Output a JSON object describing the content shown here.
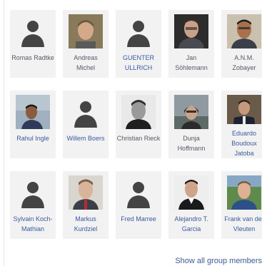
{
  "members": [
    {
      "name": "Romas Radtke",
      "has_photo": false,
      "link_color": false
    },
    {
      "name": "Andreas Michel",
      "has_photo": true,
      "link_color": false
    },
    {
      "name": "GUENTER ULLRICH",
      "has_photo": false,
      "link_color": true
    },
    {
      "name": "Jan Söhlemann",
      "has_photo": true,
      "link_color": false
    },
    {
      "name": "A.N.M. Zobayer",
      "has_photo": true,
      "link_color": false
    },
    {
      "name": "Rahul Ingle",
      "has_photo": true,
      "link_color": true
    },
    {
      "name": "Willem Boers",
      "has_photo": false,
      "link_color": true
    },
    {
      "name": "Christian Rieck",
      "has_photo": true,
      "link_color": false
    },
    {
      "name": "Dunja Hoffmann",
      "has_photo": true,
      "link_color": false
    },
    {
      "name": "Eduardo Boudoux Jatoba",
      "has_photo": true,
      "link_color": true
    },
    {
      "name": "Sylvain Koch-Mathian",
      "has_photo": false,
      "link_color": true
    },
    {
      "name": "Markus Kurdziel",
      "has_photo": true,
      "link_color": true
    },
    {
      "name": "Fred Marree",
      "has_photo": false,
      "link_color": true
    },
    {
      "name": "Alejandro T. Garcia",
      "has_photo": true,
      "link_color": true
    },
    {
      "name": "Frank van der Vleuten",
      "has_photo": true,
      "link_color": true
    }
  ],
  "footer": {
    "show_all_label": "Show all group members"
  },
  "colors": {
    "link": "#3b5aa5",
    "card_bg": "#f2f2f2",
    "silhouette": "#444444"
  }
}
